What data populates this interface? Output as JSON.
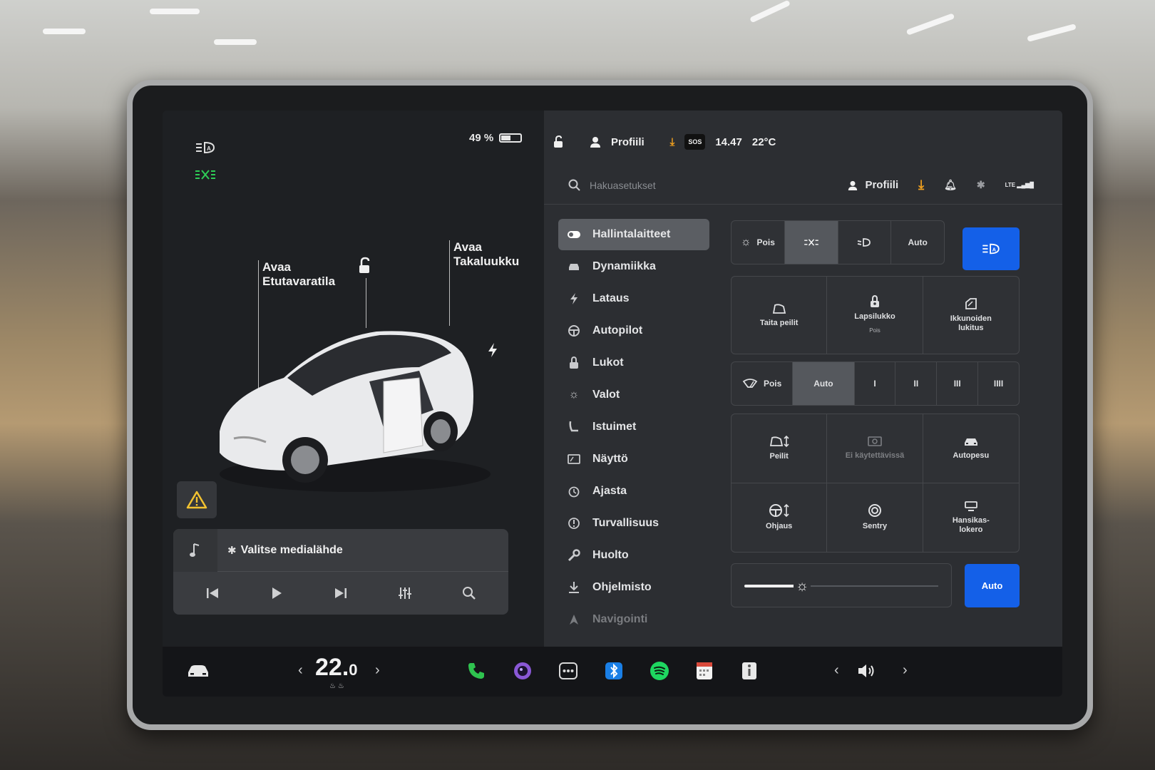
{
  "status": {
    "battery_percent": "49 %",
    "battery_level": 0.45
  },
  "left": {
    "labels": {
      "frunk_line1": "Avaa",
      "frunk_line2": "Etutavaratila",
      "trunk_line1": "Avaa",
      "trunk_line2": "Takaluukku"
    },
    "media_source": "Valitse medialähde"
  },
  "topbar": {
    "profile": "Profiili",
    "sos": "SOS",
    "time": "14.47",
    "outside_temp": "22°C"
  },
  "search": {
    "placeholder": "Hakuasetukset"
  },
  "header": {
    "profile": "Profiili",
    "lte": "LTE"
  },
  "nav": {
    "items": [
      {
        "label": "Hallintalaitteet"
      },
      {
        "label": "Dynamiikka"
      },
      {
        "label": "Lataus"
      },
      {
        "label": "Autopilot"
      },
      {
        "label": "Lukot"
      },
      {
        "label": "Valot"
      },
      {
        "label": "Istuimet"
      },
      {
        "label": "Näyttö"
      },
      {
        "label": "Ajasta"
      },
      {
        "label": "Turvallisuus"
      },
      {
        "label": "Huolto"
      },
      {
        "label": "Ohjelmisto"
      },
      {
        "label": "Navigointi"
      }
    ]
  },
  "lights": {
    "off": "Pois",
    "auto": "Auto"
  },
  "tiles_top": {
    "fold_mirrors": "Taita peilit",
    "child_lock": "Lapsilukko",
    "child_lock_state": "Pois",
    "window_lock_line1": "Ikkunoiden",
    "window_lock_line2": "lukitus"
  },
  "wipers": {
    "off": "Pois",
    "auto": "Auto",
    "speeds": [
      "I",
      "II",
      "III",
      "IIII"
    ]
  },
  "tiles_bottom": {
    "mirrors": "Peilit",
    "unavailable": "Ei käytettävissä",
    "carwash": "Autopesu",
    "steering": "Ohjaus",
    "sentry": "Sentry",
    "glovebox_line1": "Hansikas-",
    "glovebox_line2": "lokero"
  },
  "brightness": {
    "level": 0.27,
    "auto": "Auto"
  },
  "taskbar": {
    "temp_int": "22.",
    "temp_dec": "0"
  },
  "colors": {
    "accent_blue": "#1460e8",
    "headlight_green": "#2ecc56",
    "download_orange": "#f0a01e",
    "phone_green": "#2fc34f",
    "spotify_green": "#1ed760"
  }
}
